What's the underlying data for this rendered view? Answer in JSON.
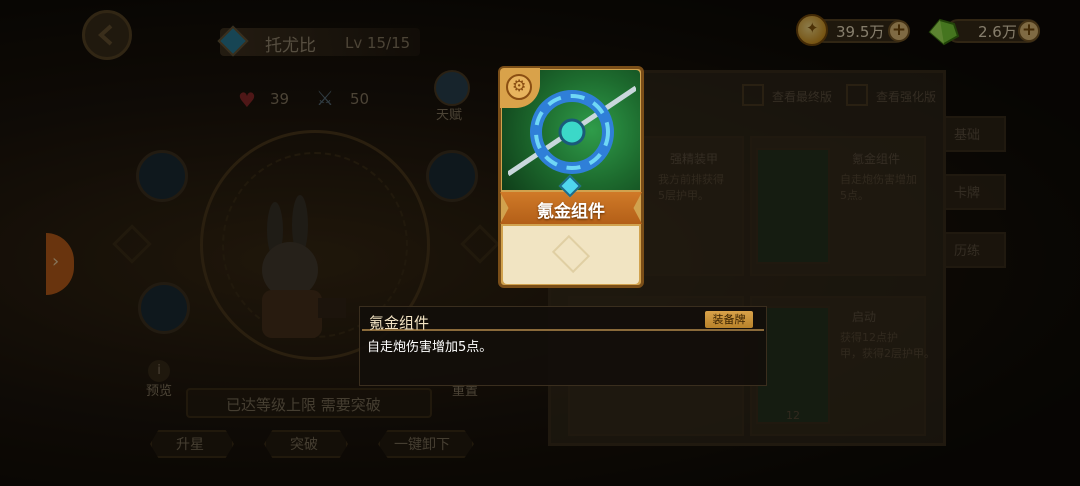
{
  "hero": {
    "name": "托尤比",
    "level": "Lv 15/15",
    "hp": "39",
    "attack": "50",
    "talent_label": "天赋",
    "preview_label": "预览",
    "reset_label": "重置",
    "max_level_text": "已达等级上限 需要突破"
  },
  "bottom_buttons": {
    "star_up": "升星",
    "breakthrough": "突破",
    "unequip_all": "一键卸下"
  },
  "currency": {
    "gold": "39.5万",
    "gems": "2.6万",
    "gold_icon": "coin-icon",
    "gem_icon": "gem-icon"
  },
  "right_panel": {
    "option_1": "查看最终版",
    "option_2": "查看强化版",
    "tabs": [
      "基础",
      "卡牌",
      "历练"
    ],
    "cards": [
      {
        "title": "强精装甲",
        "desc_1": "我方前排获得",
        "desc_2": "5层护甲。"
      },
      {
        "title": "氪金组件",
        "desc_1": "自走炮伤害增加",
        "desc_2": "5点。"
      },
      {
        "title": "",
        "desc_1": "",
        "desc_2": ""
      },
      {
        "title": "启动",
        "desc_1": "获得12点护",
        "desc_2": "甲，获得2层护甲。",
        "cost": "12"
      }
    ]
  },
  "popup_card": {
    "name": "氪金组件",
    "type_icon": "gear-icon"
  },
  "tooltip": {
    "title": "氪金组件",
    "badge": "装备牌",
    "description": "自走炮伤害增加5点。"
  },
  "side_tab_icon": "chevron-right-icon"
}
